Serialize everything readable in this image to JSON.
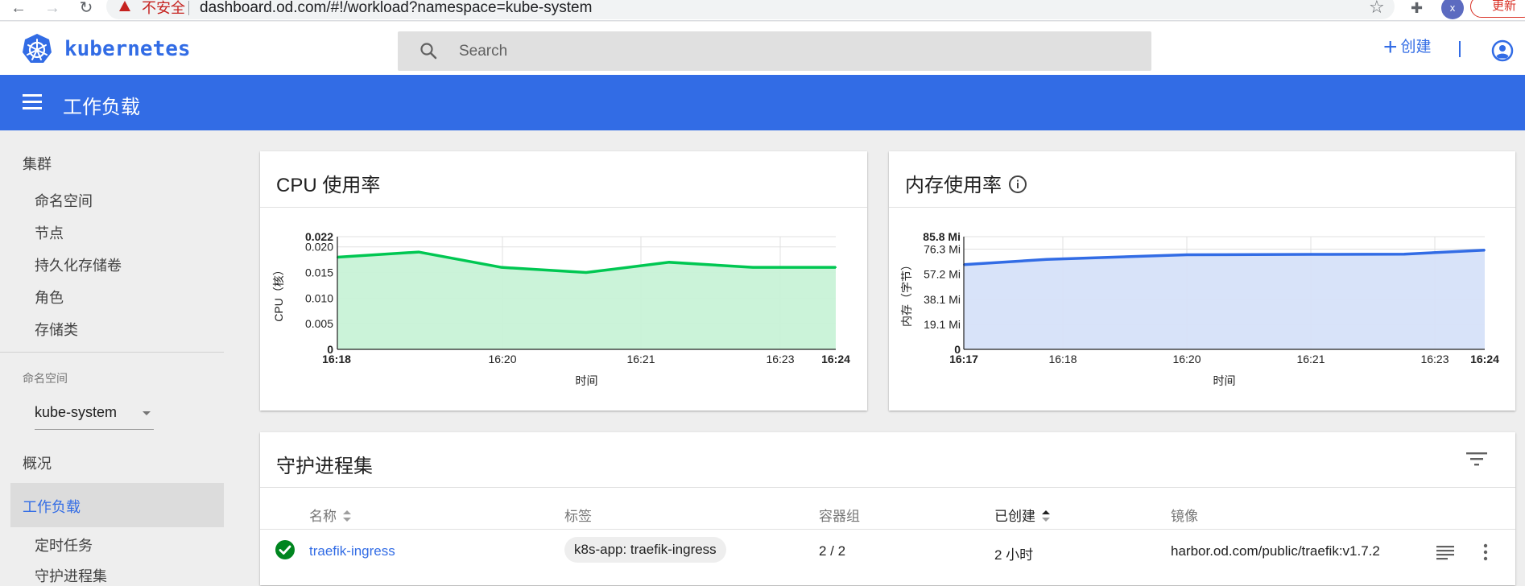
{
  "browser": {
    "back_icon": "arrow-left-icon",
    "forward_icon": "arrow-right-icon",
    "reload_icon": "reload-icon",
    "security_warning": "不安全",
    "url": "dashboard.od.com/#!/workload?namespace=kube-system",
    "profile_initial": "x",
    "update_label": "更新"
  },
  "header": {
    "brand": "kubernetes",
    "search_placeholder": "Search",
    "create_label": "创建"
  },
  "title_bar": {
    "title": "工作负载"
  },
  "sidebar": {
    "cluster_heading": "集群",
    "cluster_items": [
      "命名空间",
      "节点",
      "持久化存储卷",
      "角色",
      "存储类"
    ],
    "namespace_label": "命名空间",
    "namespace_value": "kube-system",
    "overview": "概况",
    "workloads": "工作负载",
    "sub_items": [
      "定时任务",
      "守护进程集"
    ]
  },
  "cpu_card": {
    "title": "CPU 使用率"
  },
  "memory_card": {
    "title": "内存使用率"
  },
  "chart_data": [
    {
      "type": "area",
      "title": "CPU 使用率",
      "xlabel": "时间",
      "ylabel": "CPU（核）",
      "x": [
        "16:18",
        "16:19",
        "16:20",
        "16:21",
        "16:21",
        "16:22",
        "16:23",
        "16:24"
      ],
      "values": [
        0.018,
        0.019,
        0.016,
        0.015,
        0.017,
        0.016,
        0.016,
        0.016
      ],
      "x_ticks": [
        "16:18",
        "16:20",
        "16:21",
        "16:23",
        "16:24"
      ],
      "y_ticks": [
        "0",
        "0.005",
        "0.010",
        "0.015",
        "0.020",
        "0.022"
      ],
      "ylim": [
        0,
        0.022
      ],
      "color": "#00c752",
      "fill": "#c8f2d7",
      "grid": true
    },
    {
      "type": "area",
      "title": "内存使用率",
      "xlabel": "时间",
      "ylabel": "内存（字节）",
      "x": [
        "16:17",
        "16:18",
        "16:20",
        "16:21",
        "16:23",
        "16:24"
      ],
      "values": [
        64.5,
        68.5,
        72.0,
        72.3,
        72.5,
        75.5
      ],
      "x_ticks": [
        "16:17",
        "16:18",
        "16:20",
        "16:21",
        "16:23",
        "16:24"
      ],
      "y_ticks": [
        "0",
        "19.1 Mi",
        "38.1 Mi",
        "57.2 Mi",
        "76.3 Mi",
        "85.8 Mi"
      ],
      "ylim": [
        0,
        85.8
      ],
      "unit": "Mi",
      "color": "#326ce5",
      "fill": "#d6e1f9",
      "grid": true
    }
  ],
  "daemonsets": {
    "title": "守护进程集",
    "columns": {
      "name": "名称",
      "labels": "标签",
      "pods": "容器组",
      "created": "已创建",
      "image": "镜像"
    },
    "rows": [
      {
        "status": "ok",
        "name": "traefik-ingress",
        "label": "k8s-app: traefik-ingress",
        "pods": "2 / 2",
        "created": "2 小时",
        "image": "harbor.od.com/public/traefik:v1.7.2"
      }
    ]
  }
}
